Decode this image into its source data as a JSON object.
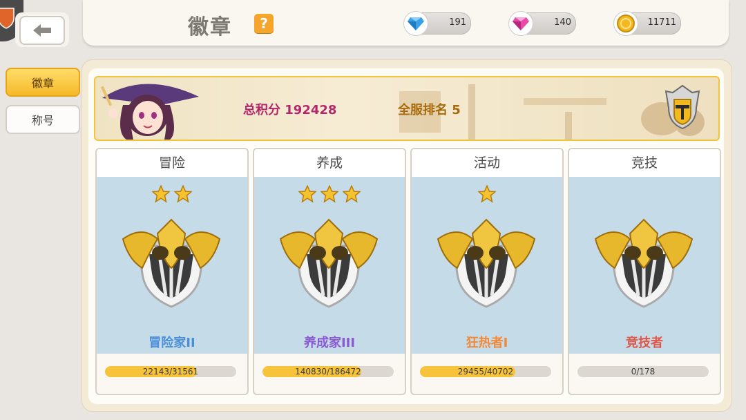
{
  "header": {
    "title": "徽章",
    "help_label": "?",
    "currencies": [
      {
        "name": "blue-gem",
        "amount": "191",
        "color": "#3aa0e8"
      },
      {
        "name": "pink-gem",
        "amount": "140",
        "color": "#e84aa8"
      },
      {
        "name": "gold-coin",
        "amount": "11711",
        "color": "#f2b820"
      }
    ]
  },
  "sidebar": {
    "tabs": [
      {
        "label": "徽章",
        "active": true
      },
      {
        "label": "称号",
        "active": false
      }
    ]
  },
  "banner": {
    "score_text": "总积分 192428",
    "rank_text": "全服排名 5"
  },
  "categories": [
    {
      "title": "冒险",
      "stars": 2,
      "rank_name": "冒险家II",
      "rank_color": "#4a90d9",
      "progress_text": "22143/31561",
      "progress": 0.7016
    },
    {
      "title": "养成",
      "stars": 3,
      "rank_name": "养成家III",
      "rank_color": "#8a5ad6",
      "progress_text": "140830/186472",
      "progress": 0.7552
    },
    {
      "title": "活动",
      "stars": 1,
      "rank_name": "狂热者I",
      "rank_color": "#f08a3a",
      "progress_text": "29455/40702",
      "progress": 0.7237
    },
    {
      "title": "竞技",
      "stars": 0,
      "rank_name": "竞技者",
      "rank_color": "#e0584a",
      "progress_text": "0/178",
      "progress": 0
    }
  ]
}
